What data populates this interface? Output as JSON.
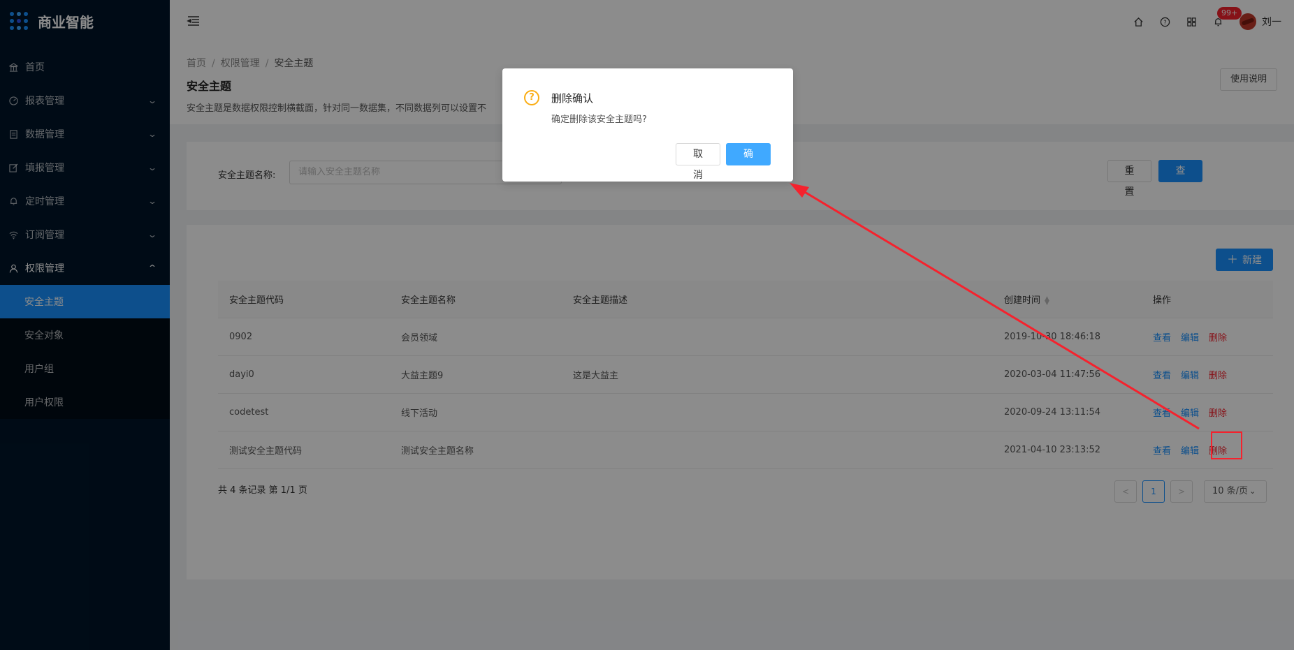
{
  "app": {
    "title": "商业智能"
  },
  "sidebar": {
    "items": [
      {
        "label": "首页",
        "icon": "bank-icon"
      },
      {
        "label": "报表管理",
        "icon": "dashboard-icon"
      },
      {
        "label": "数据管理",
        "icon": "database-icon"
      },
      {
        "label": "填报管理",
        "icon": "form-icon"
      },
      {
        "label": "定时管理",
        "icon": "bell-icon"
      },
      {
        "label": "订阅管理",
        "icon": "wifi-icon"
      },
      {
        "label": "权限管理",
        "icon": "user-icon"
      }
    ],
    "submenu": [
      {
        "label": "安全主题",
        "active": true
      },
      {
        "label": "安全对象"
      },
      {
        "label": "用户组"
      },
      {
        "label": "用户权限"
      }
    ]
  },
  "header": {
    "badge": "99+",
    "username": "刘一"
  },
  "page": {
    "breadcrumb": [
      "首页",
      "权限管理",
      "安全主题"
    ],
    "title": "安全主题",
    "description": "安全主题是数据权限控制横截面，针对同一数据集，不同数据列可以设置不",
    "help_label": "使用说明"
  },
  "search": {
    "label": "安全主题名称:",
    "placeholder": "请输入安全主题名称",
    "reset_label": "重 置",
    "query_label": "查 询"
  },
  "table": {
    "new_label": "新建",
    "columns": [
      "安全主题代码",
      "安全主题名称",
      "安全主题描述",
      "创建时间",
      "操作"
    ],
    "rows": [
      {
        "code": "0902",
        "name": "会员领域",
        "desc": "",
        "time": "2019-10-30 18:46:18"
      },
      {
        "code": "dayi0",
        "name": "大益主题9",
        "desc": "这是大益主",
        "time": "2020-03-04 11:47:56"
      },
      {
        "code": "codetest",
        "name": "线下活动",
        "desc": "",
        "time": "2020-09-24 13:11:54"
      },
      {
        "code": "测试安全主题代码",
        "name": "测试安全主题名称",
        "desc": "",
        "time": "2021-04-10 23:13:52"
      }
    ],
    "actions": {
      "view": "查看",
      "edit": "编辑",
      "delete": "删除"
    },
    "total": "共 4 条记录 第 1/1 页",
    "page_current": "1",
    "page_size": "10 条/页"
  },
  "dialog": {
    "title": "删除确认",
    "content": "确定删除该安全主题吗?",
    "cancel_label": "取 消",
    "ok_label": "确 定"
  },
  "colors": {
    "sidebar_bg": "#001529",
    "primary": "#1890ff",
    "danger": "#f5222d",
    "warning": "#faad14"
  }
}
